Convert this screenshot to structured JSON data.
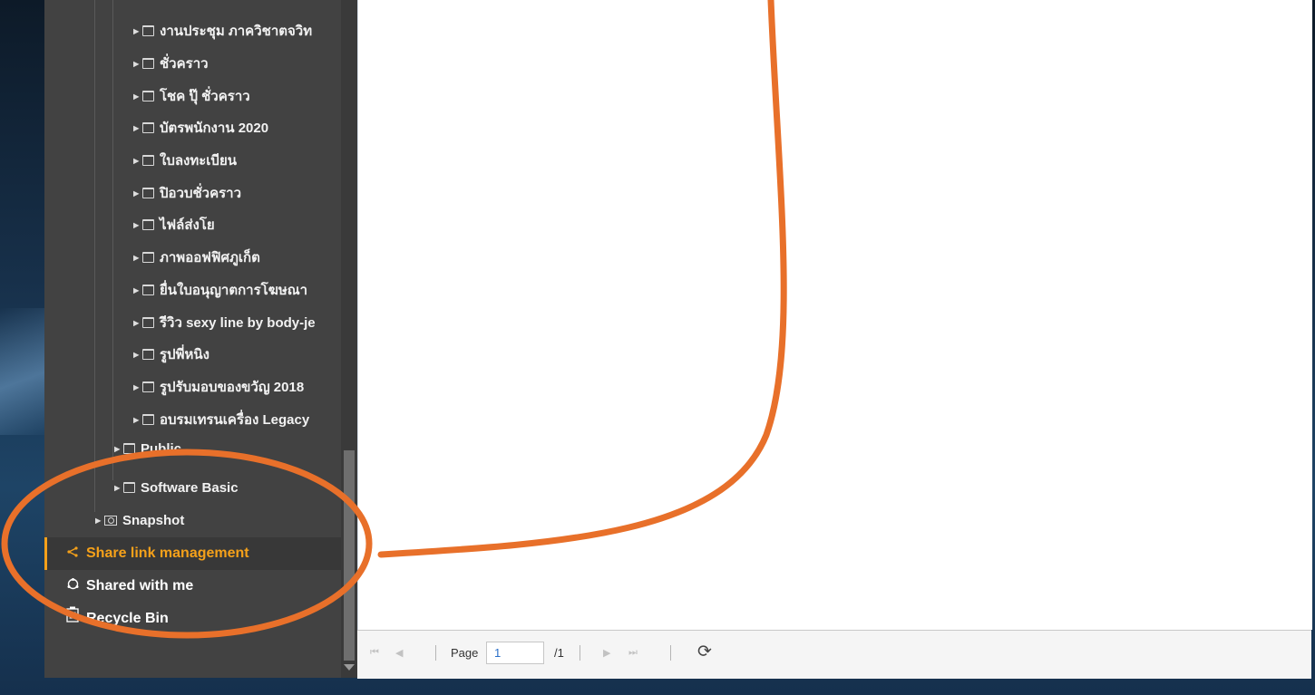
{
  "folder_tree": [
    {
      "label": "งานประชุม ภาควิชาตจวิท"
    },
    {
      "label": "ชั่วคราว"
    },
    {
      "label": "โชค ปุ๊ ชั่วคราว"
    },
    {
      "label": "บัตรพนักงาน 2020"
    },
    {
      "label": "ใบลงทะเบียน"
    },
    {
      "label": "ปิอวบชั่วคราว"
    },
    {
      "label": "ไฟล์ส่งโย"
    },
    {
      "label": "ภาพออฟฟิศภูเก็ต"
    },
    {
      "label": "ยื่นใบอนุญาตการโฆษณา"
    },
    {
      "label": "รีวิว sexy line by body-je"
    },
    {
      "label": "รูปพี่หนิง"
    },
    {
      "label": "รูปรับมอบของขวัญ 2018"
    },
    {
      "label": "อบรมเทรนเครื่อง Legacy"
    }
  ],
  "parent_folders": {
    "public": "Public",
    "software_basic": "Software Basic",
    "snapshot": "Snapshot"
  },
  "nav": {
    "share_link_management": "Share link management",
    "shared_with_me": "Shared with me",
    "recycle_bin": "Recycle Bin"
  },
  "pager": {
    "page_label": "Page",
    "current_page": "1",
    "total_pages": "/1"
  },
  "colors": {
    "accent": "#f5a11a",
    "annotation": "#e8702a",
    "sidebar_bg": "#424242"
  },
  "icons": {
    "folder": "folder-icon",
    "snapshot": "camera-icon",
    "share": "share-icon",
    "shared": "shared-circle-icon",
    "recycle": "recycle-bin-icon",
    "refresh": "refresh-icon"
  }
}
